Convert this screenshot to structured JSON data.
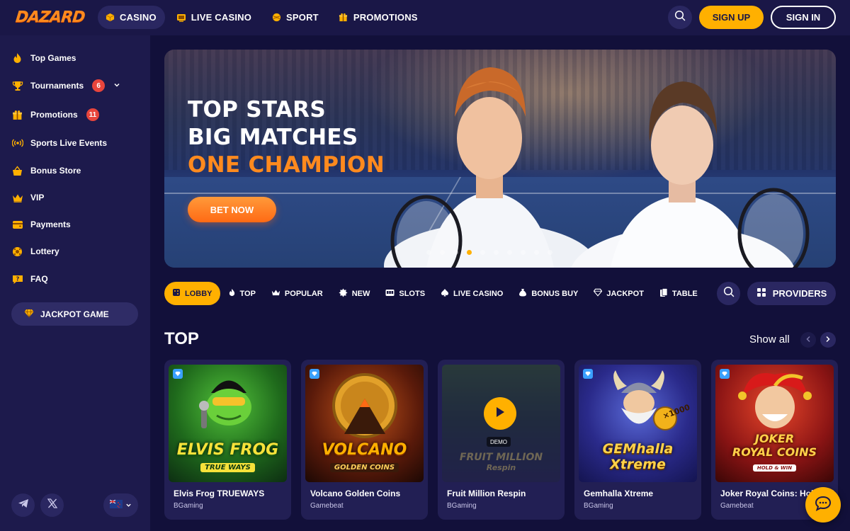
{
  "header": {
    "logo": "DAZARD",
    "nav": [
      {
        "label": "CASINO",
        "icon": "casino-cube-icon",
        "active": true
      },
      {
        "label": "LIVE CASINO",
        "icon": "live-tv-icon"
      },
      {
        "label": "SPORT",
        "icon": "sport-ball-icon"
      },
      {
        "label": "PROMOTIONS",
        "icon": "gift-icon"
      }
    ],
    "sign_up": "SIGN UP",
    "sign_in": "SIGN IN"
  },
  "sidebar": {
    "items": [
      {
        "label": "Top Games",
        "icon": "flame-icon"
      },
      {
        "label": "Tournaments",
        "icon": "trophy-icon",
        "badge": "6"
      },
      {
        "label": "Promotions",
        "icon": "gift-icon",
        "badge": "11"
      },
      {
        "label": "Sports Live Events",
        "icon": "broadcast-icon"
      },
      {
        "label": "Bonus Store",
        "icon": "basket-icon"
      },
      {
        "label": "VIP",
        "icon": "crown-icon"
      },
      {
        "label": "Payments",
        "icon": "wallet-icon"
      },
      {
        "label": "Lottery",
        "icon": "lottery-ball-icon"
      },
      {
        "label": "FAQ",
        "icon": "question-icon"
      }
    ],
    "jackpot": "JACKPOT GAME"
  },
  "banner": {
    "line1": "TOP STARS",
    "line2": "BIG MATCHES",
    "line3": "ONE CHAMPION",
    "cta": "BET NOW",
    "slides": 10,
    "active_slide": 3
  },
  "categories": [
    {
      "label": "LOBBY",
      "icon": "dice-icon",
      "active": true
    },
    {
      "label": "TOP",
      "icon": "flame-icon"
    },
    {
      "label": "POPULAR",
      "icon": "crown-icon"
    },
    {
      "label": "NEW",
      "icon": "new-burst-icon"
    },
    {
      "label": "SLOTS",
      "icon": "slot-machine-icon"
    },
    {
      "label": "LIVE CASINO",
      "icon": "spade-icon"
    },
    {
      "label": "BONUS BUY",
      "icon": "bonus-bag-icon"
    },
    {
      "label": "JACKPOT",
      "icon": "jackpot-gem-icon"
    },
    {
      "label": "TABLE",
      "icon": "cards-icon"
    }
  ],
  "providers": "PROVIDERS",
  "top_section": {
    "title": "TOP",
    "show_all": "Show all",
    "games": [
      {
        "name": "Elvis Frog TRUEWAYS",
        "provider": "BGaming",
        "art1": "ELVIS FROG",
        "art2": "TRUE WAYS"
      },
      {
        "name": "Volcano Golden Coins",
        "provider": "Gamebeat",
        "art1": "VOLCANO",
        "art2": "GOLDEN COINS"
      },
      {
        "name": "Fruit Million Respin",
        "provider": "BGaming",
        "art1": "FRUIT MILLION",
        "art2": "Respin",
        "demo": "DEMO"
      },
      {
        "name": "Gemhalla Xtreme",
        "provider": "BGaming",
        "art1": "GEMhalla",
        "art2": "Xtreme",
        "art3": "×1000"
      },
      {
        "name": "Joker Royal Coins: Hold & Win",
        "provider": "Gamebeat",
        "art1": "JOKER",
        "art2": "ROYAL COINS",
        "art3": "HOLD & WIN"
      }
    ]
  }
}
